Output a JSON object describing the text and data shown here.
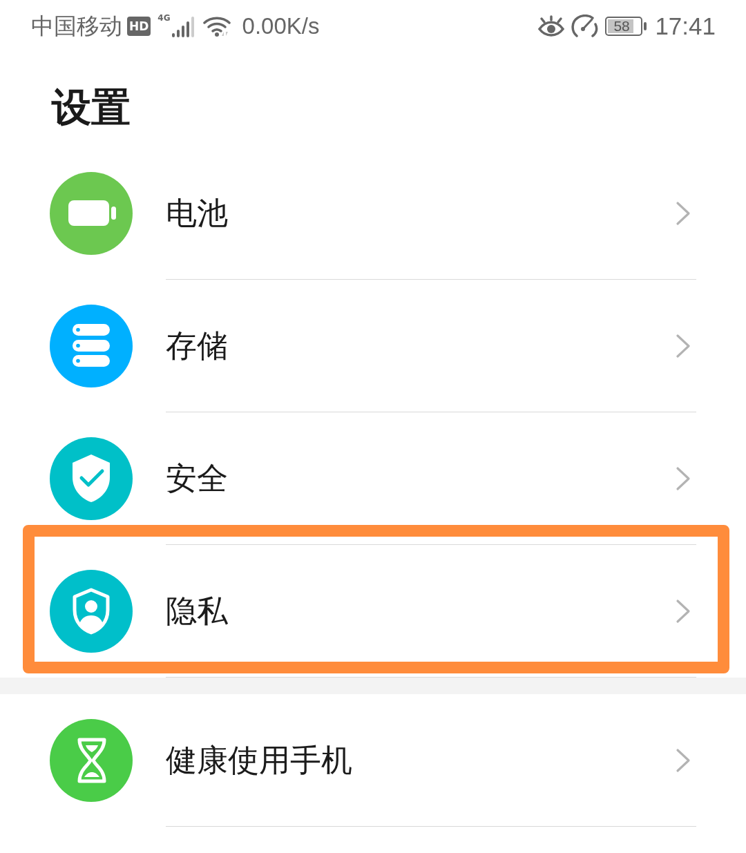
{
  "status_bar": {
    "carrier": "中国移动",
    "hd_badge": "HD",
    "network": "4G",
    "speed": "0.00K/s",
    "battery": "58",
    "time": "17:41"
  },
  "title": "设置",
  "groups": [
    {
      "items": [
        {
          "kind": "battery",
          "label": "电池",
          "color": "#6cc850",
          "highlighted": false
        },
        {
          "kind": "storage",
          "label": "存储",
          "color": "#00b0ff",
          "highlighted": false
        },
        {
          "kind": "security",
          "label": "安全",
          "color": "#00c0c8",
          "highlighted": false
        },
        {
          "kind": "privacy",
          "label": "隐私",
          "color": "#00bfca",
          "highlighted": true
        }
      ]
    },
    {
      "items": [
        {
          "kind": "wellbeing",
          "label": "健康使用手机",
          "color": "#4acc48",
          "highlighted": false
        }
      ]
    }
  ]
}
